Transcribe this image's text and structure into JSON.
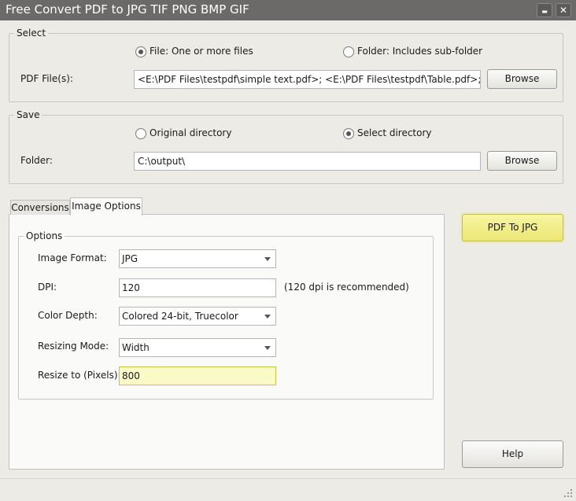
{
  "window": {
    "title": "Free Convert PDF to JPG TIF PNG BMP GIF",
    "minimize_glyph": "▬",
    "close_glyph": "✕"
  },
  "select_group": {
    "legend": "Select",
    "radio_file_label": "File:  One or more files",
    "radio_folder_label": "Folder: Includes sub-folder",
    "pdf_files_label": "PDF File(s):",
    "pdf_files_value": "<E:\\PDF Files\\testpdf\\simple text.pdf>; <E:\\PDF Files\\testpdf\\Table.pdf>; <E:\\PDF",
    "browse_label": "Browse"
  },
  "save_group": {
    "legend": "Save",
    "radio_original_label": "Original directory",
    "radio_select_label": "Select directory",
    "folder_label": "Folder:",
    "folder_value": "C:\\output\\",
    "browse_label": "Browse"
  },
  "tabs": [
    {
      "label": "Conversions",
      "active": false
    },
    {
      "label": "Image Options",
      "active": true
    }
  ],
  "options_group": {
    "legend": "Options",
    "image_format_label": "Image Format:",
    "image_format_value": "JPG",
    "dpi_label": "DPI:",
    "dpi_value": "120",
    "dpi_hint": "(120 dpi is recommended)",
    "color_depth_label": "Color Depth:",
    "color_depth_value": "Colored 24-bit, Truecolor",
    "resizing_mode_label": "Resizing Mode:",
    "resizing_mode_value": "Width",
    "resize_to_label": "Resize to (Pixels):",
    "resize_to_value": "800"
  },
  "actions": {
    "convert_label": "PDF To JPG",
    "help_label": "Help"
  },
  "colors": {
    "titlebar": "#6b6a69",
    "window_bg": "#ecebe5",
    "highlight_yellow": "#f3f08a",
    "input_highlight": "#fafac6"
  }
}
